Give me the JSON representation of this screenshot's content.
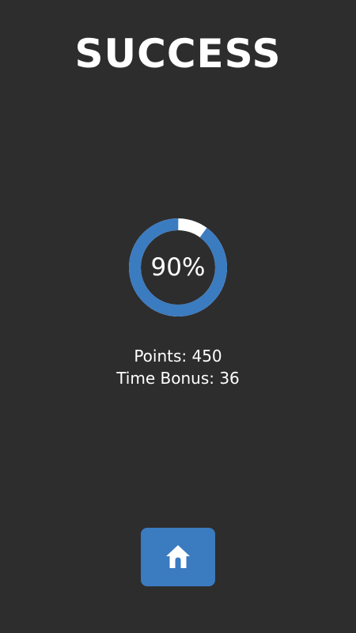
{
  "title": "SUCCESS",
  "progress": {
    "value": 0.9,
    "label": "90%",
    "color": "#3b7bc0",
    "track_color": "#ffffff"
  },
  "stats": {
    "points": "Points: 450",
    "time_bonus": "Time Bonus: 36"
  },
  "home_button": {
    "icon": "home-icon",
    "color": "#3b7bc0"
  },
  "colors": {
    "background": "#2d2d2d",
    "text": "#ffffff"
  }
}
